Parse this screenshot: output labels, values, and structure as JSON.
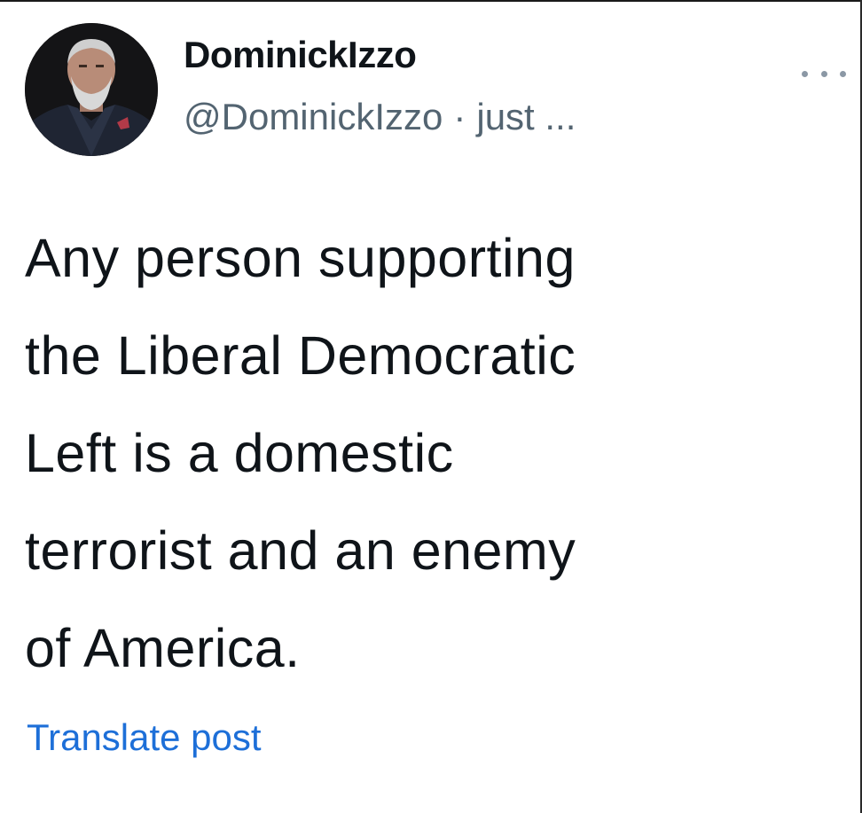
{
  "post": {
    "author": {
      "display_name": "DominickIzzo",
      "handle": "@DominickIzzo",
      "separator": "·",
      "timestamp": "just ...",
      "avatar_icon": "profile-photo"
    },
    "more_icon": "ellipsis-icon",
    "text": "Any person supporting\nthe Liberal Democratic\nLeft is a domestic\nterrorist and an enemy\nof America.",
    "translate_label": "Translate post"
  },
  "colors": {
    "text_primary": "#0f1419",
    "text_secondary": "#536471",
    "link": "#1d6fd8",
    "background": "#ffffff"
  }
}
